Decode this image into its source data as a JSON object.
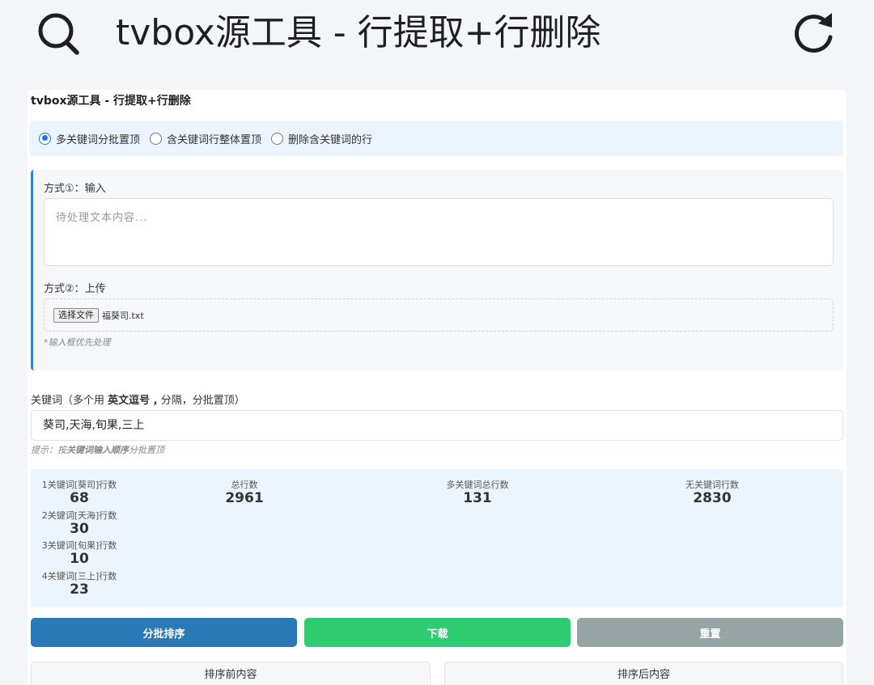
{
  "appbar": {
    "title": "tvbox源工具 - 行提取+行删除",
    "search_icon": "search-icon",
    "refresh_icon": "refresh-icon"
  },
  "card": {
    "title": "tvbox源工具 - 行提取+行删除"
  },
  "modes": [
    {
      "label": "多关键词分批置顶",
      "checked": true
    },
    {
      "label": "含关键词行整体置顶",
      "checked": false
    },
    {
      "label": "删除含关键词的行",
      "checked": false
    }
  ],
  "input": {
    "method1_label": "方式①：输入",
    "textarea_placeholder": "待处理文本内容...",
    "method2_label": "方式②：上传",
    "file_button": "选择文件",
    "file_name": "福葵司.txt",
    "priority_hint": "*输入框优先处理"
  },
  "keywords": {
    "label_prefix": "关键词（多个用 ",
    "label_bold": "英文逗号 ,",
    "label_suffix": " 分隔，分批置顶）",
    "value": "葵司,天海,旬果,三上",
    "tip_prefix": "提示：按",
    "tip_bold": "关键词输入顺序",
    "tip_suffix": "分批置顶"
  },
  "stats": {
    "per_keyword": [
      {
        "label": "1关键词[葵司]行数",
        "value": "68"
      },
      {
        "label": "2关键词[天海]行数",
        "value": "30"
      },
      {
        "label": "3关键词[旬果]行数",
        "value": "10"
      },
      {
        "label": "4关键词[三上]行数",
        "value": "23"
      }
    ],
    "total": {
      "label": "总行数",
      "value": "2961"
    },
    "multi": {
      "label": "多关键词总行数",
      "value": "131"
    },
    "none": {
      "label": "无关键词行数",
      "value": "2830"
    }
  },
  "buttons": {
    "sort": "分批排序",
    "download": "下载",
    "reset": "重置"
  },
  "panes": {
    "before": "排序前内容",
    "after": "排序后内容"
  },
  "colors": {
    "primary": "#2a7ab8",
    "success": "#2ecc71",
    "muted": "#95a5a6",
    "accent_border": "#2e86c9",
    "panel_bg": "#ecf5fd"
  }
}
